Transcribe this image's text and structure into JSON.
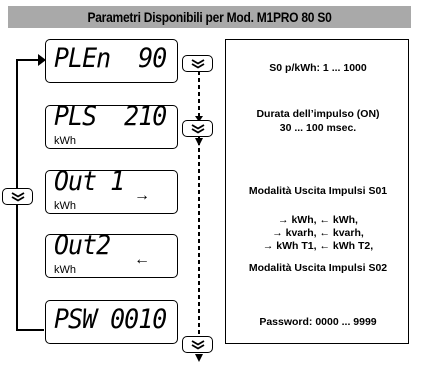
{
  "title": "Parametri Disponibili per Mod. M1PRO 80 S0",
  "displays": [
    {
      "main": "PLEn  90",
      "unit": "",
      "indicator": ""
    },
    {
      "main": "PLS  210",
      "unit": "kWh",
      "indicator": ""
    },
    {
      "main": "Out 1",
      "unit": "kWh",
      "indicator": "→"
    },
    {
      "main": "Out2",
      "unit": "kWh",
      "indicator": "←"
    },
    {
      "main": "PSW 0010",
      "unit": "",
      "indicator": ""
    }
  ],
  "descriptions": {
    "s0_rate": "S0 p/kWh: 1 ... 1000",
    "pulse_duration_l1": "Durata dell’impulso (ON)",
    "pulse_duration_l2": "30 ... 100 msec.",
    "output_s01": "Modalità Uscita Impulsi S01",
    "modes_l1": "→ kWh, ← kWh,",
    "modes_l2": "→ kvarh, ← kvarh,",
    "modes_l3": "→ kWh T1, ← kWh T2,",
    "output_s02": "Modalità Uscita Impulsi S02",
    "password": "Password: 0000 ... 9999"
  },
  "icons": {
    "button": "double-chevron-down-icon"
  }
}
